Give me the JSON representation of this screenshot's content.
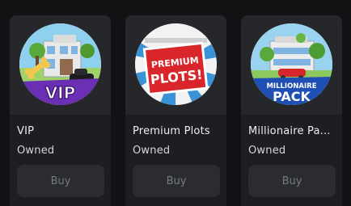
{
  "products": [
    {
      "name": "VIP",
      "status": "Owned",
      "buy_label": "Buy",
      "badge_text": "VIP",
      "icon": "vip-house-icon"
    },
    {
      "name": "Premium Plots",
      "status": "Owned",
      "buy_label": "Buy",
      "badge_text_line1": "PREMIUM",
      "badge_text_line2": "PLOTS!",
      "icon": "premium-plots-sign-icon"
    },
    {
      "name": "Millionaire Pa...",
      "status": "Owned",
      "buy_label": "Buy",
      "badge_text_line1": "MILLIONAIRE",
      "badge_text_line2": "PACK",
      "icon": "millionaire-pack-icon"
    }
  ],
  "colors": {
    "background": "#111214",
    "card": "#1d1e21",
    "thumb": "#26272b",
    "button": "#2b2c30",
    "button_text": "#767a82",
    "vip_purple": "#6b2fb3",
    "plots_red": "#d8262b",
    "pack_blue": "#1f4fb5"
  }
}
